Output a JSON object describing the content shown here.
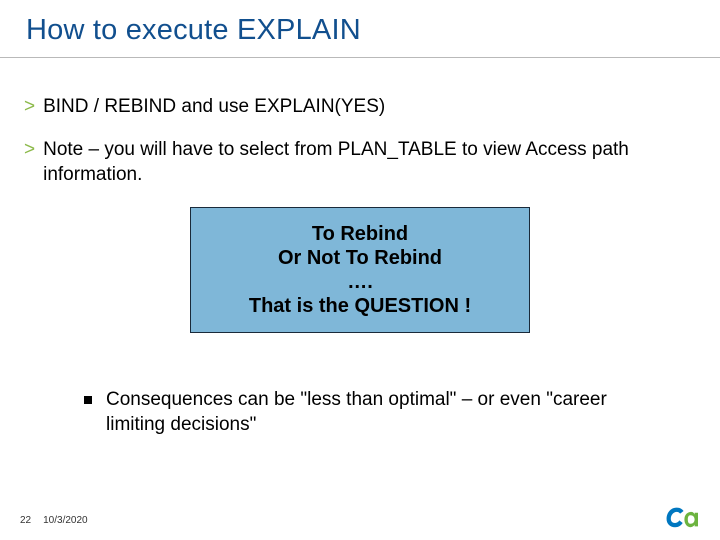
{
  "title": "How to execute EXPLAIN",
  "bullets": [
    {
      "text": "BIND / REBIND and use EXPLAIN(YES)"
    },
    {
      "text": "Note – you will have to select from PLAN_TABLE to view Access path information."
    }
  ],
  "callout": {
    "line1": "To Rebind",
    "line2": "Or Not To Rebind",
    "line3": "….",
    "line4": "That is the QUESTION !"
  },
  "sub_bullet": "Consequences can be \"less than optimal\" – or even \"career limiting decisions\"",
  "footer": {
    "page": "22",
    "date": "10/3/2020"
  }
}
